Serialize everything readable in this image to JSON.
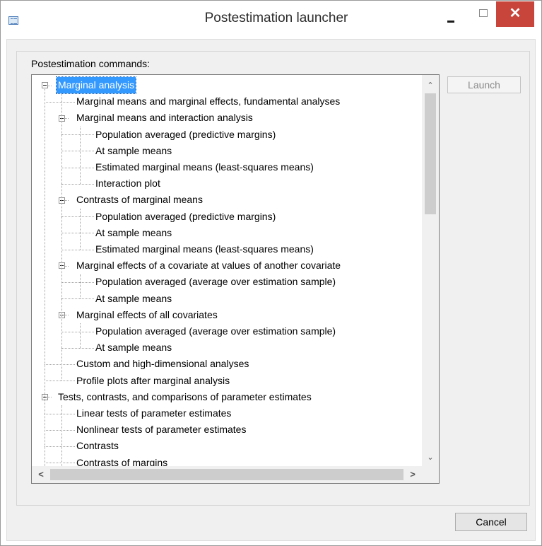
{
  "window": {
    "title": "Postestimation launcher",
    "close_glyph": "✕"
  },
  "panel": {
    "label": "Postestimation commands:"
  },
  "tree": {
    "items": [
      {
        "label": "Marginal analysis",
        "level": 0,
        "expander": true,
        "selected": true
      },
      {
        "label": "Marginal means and marginal effects, fundamental analyses",
        "level": 1,
        "expander": false
      },
      {
        "label": "Marginal means and interaction analysis",
        "level": 1,
        "expander": true
      },
      {
        "label": "Population averaged (predictive margins)",
        "level": 2,
        "expander": false
      },
      {
        "label": "At sample means",
        "level": 2,
        "expander": false
      },
      {
        "label": "Estimated marginal means (least-squares means)",
        "level": 2,
        "expander": false
      },
      {
        "label": "Interaction plot",
        "level": 2,
        "expander": false
      },
      {
        "label": "Contrasts of marginal means",
        "level": 1,
        "expander": true
      },
      {
        "label": "Population averaged (predictive margins)",
        "level": 2,
        "expander": false
      },
      {
        "label": "At sample means",
        "level": 2,
        "expander": false
      },
      {
        "label": "Estimated marginal means (least-squares means)",
        "level": 2,
        "expander": false
      },
      {
        "label": "Marginal effects of a covariate at values of another covariate",
        "level": 1,
        "expander": true
      },
      {
        "label": "Population averaged (average over estimation sample)",
        "level": 2,
        "expander": false
      },
      {
        "label": "At sample means",
        "level": 2,
        "expander": false
      },
      {
        "label": "Marginal effects of all covariates",
        "level": 1,
        "expander": true
      },
      {
        "label": "Population averaged (average over estimation sample)",
        "level": 2,
        "expander": false
      },
      {
        "label": "At sample means",
        "level": 2,
        "expander": false
      },
      {
        "label": "Custom and high-dimensional analyses",
        "level": 1,
        "expander": false
      },
      {
        "label": "Profile plots after marginal analysis",
        "level": 1,
        "expander": false
      },
      {
        "label": "Tests, contrasts, and comparisons of parameter estimates",
        "level": 0,
        "expander": true
      },
      {
        "label": "Linear tests of parameter estimates",
        "level": 1,
        "expander": false
      },
      {
        "label": "Nonlinear tests of parameter estimates",
        "level": 1,
        "expander": false
      },
      {
        "label": "Contrasts",
        "level": 1,
        "expander": false
      },
      {
        "label": "Contrasts of margins",
        "level": 1,
        "expander": false
      }
    ]
  },
  "scrollbar": {
    "up_glyph": "⌃",
    "down_glyph": "⌄",
    "left_glyph": "<",
    "right_glyph": ">"
  },
  "buttons": {
    "launch_label": "Launch",
    "cancel_label": "Cancel"
  }
}
